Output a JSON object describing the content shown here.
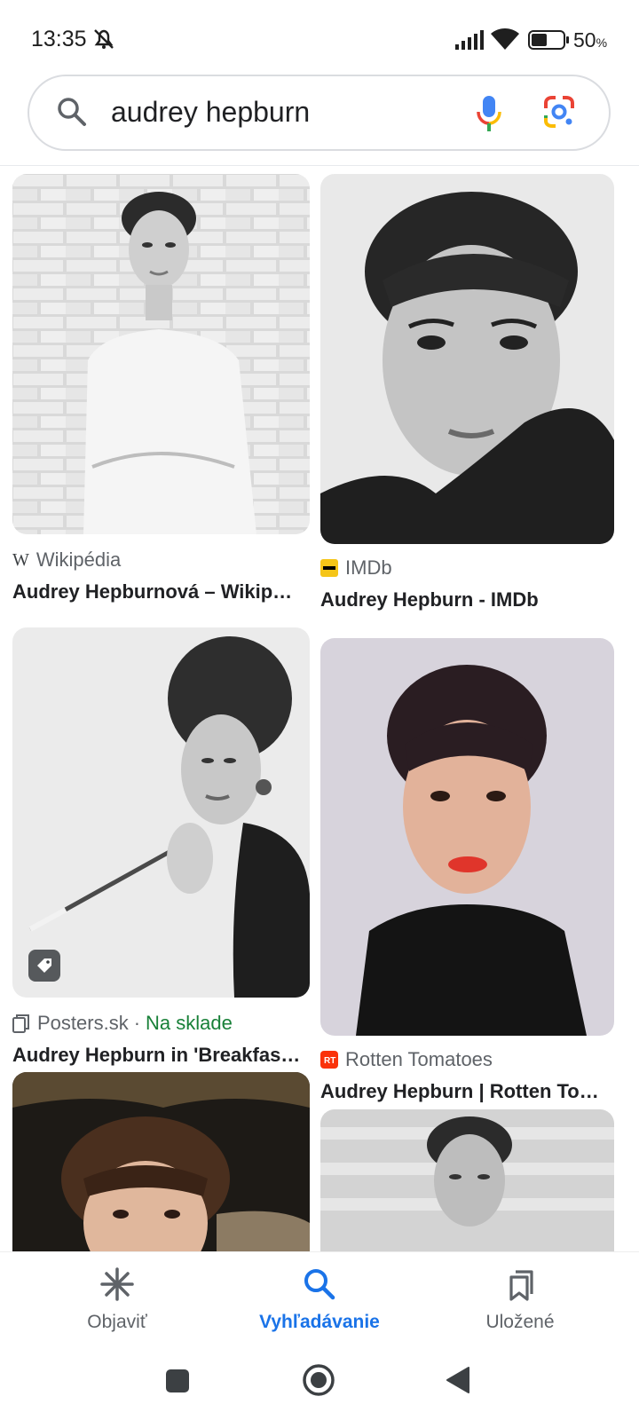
{
  "status_bar": {
    "time": "13:35",
    "battery_percent": "50",
    "battery_unit": "%",
    "icons": [
      "mute-icon",
      "signal-icon",
      "wifi-icon",
      "battery-icon"
    ]
  },
  "search": {
    "query": "audrey hepburn",
    "icons": [
      "search-icon",
      "microphone-icon",
      "google-lens-icon"
    ]
  },
  "results": [
    {
      "source": "Wikipédia",
      "source_icon": "wikipedia-icon",
      "title": "Audrey Hepburnová – Wikip…"
    },
    {
      "source": "IMDb",
      "source_icon": "imdb-icon",
      "title": "Audrey Hepburn - IMDb"
    },
    {
      "source": "Posters.sk",
      "source_icon": "shopping-icon",
      "stock_separator": "·",
      "stock": "Na sklade",
      "badge_icon": "tag-icon",
      "title": "Audrey Hepburn in 'Breakfas…"
    },
    {
      "source": "Rotten Tomatoes",
      "source_icon": "rotten-tomatoes-icon",
      "title": "Audrey Hepburn | Rotten To…"
    },
    {
      "source": "",
      "title": ""
    },
    {
      "source": "",
      "title": ""
    }
  ],
  "bottom_nav": {
    "items": [
      {
        "label": "Objaviť",
        "icon": "discover-asterisk-icon",
        "active": false
      },
      {
        "label": "Vyhľadávanie",
        "icon": "search-icon",
        "active": true
      },
      {
        "label": "Uložené",
        "icon": "bookmarks-icon",
        "active": false
      }
    ]
  },
  "colors": {
    "accent": "#1a73e8",
    "stock_green": "#188038",
    "text_secondary": "#5f6368"
  }
}
